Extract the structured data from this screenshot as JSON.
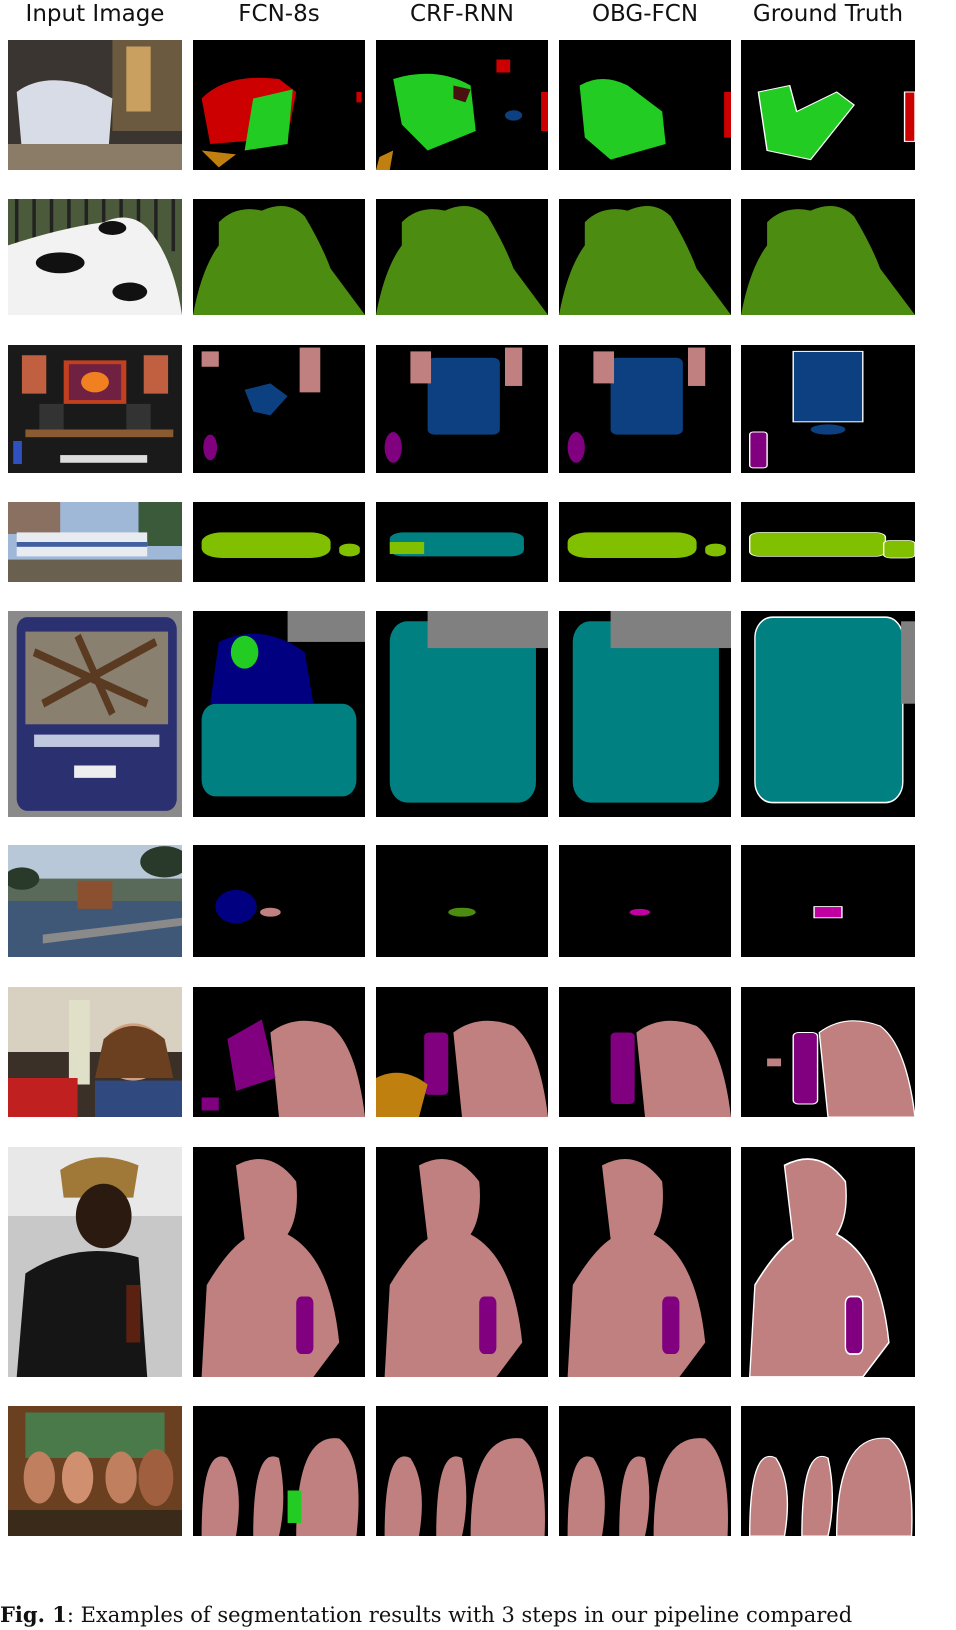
{
  "columns": [
    "Input Image",
    "FCN-8s",
    "CRF-RNN",
    "OBG-FCN",
    "Ground Truth"
  ],
  "rows": [
    {
      "scene": "living room with sofa",
      "shapes": [
        "sofa",
        "sofa-alt",
        "sofa-clean",
        "sofa-gt"
      ]
    },
    {
      "scene": "cow lying down",
      "shapes": [
        "cow",
        "cow",
        "cow",
        "cow"
      ]
    },
    {
      "scene": "desk with computer monitor",
      "shapes": [
        "monitor-fcn",
        "monitor",
        "monitor",
        "monitor-gt"
      ]
    },
    {
      "scene": "train on tracks",
      "shapes": [
        "train",
        "train-teal",
        "train",
        "train-gt"
      ]
    },
    {
      "scene": "bus front",
      "shapes": [
        "bus-fcn",
        "bus",
        "bus",
        "bus-gt"
      ]
    },
    {
      "scene": "harbor with boats",
      "shapes": [
        "harbor-fcn",
        "harbor-crf",
        "harbor-obg",
        "harbor-gt"
      ]
    },
    {
      "scene": "woman with bottle",
      "shapes": [
        "woman-fcn",
        "woman-crf",
        "woman",
        "woman-gt"
      ]
    },
    {
      "scene": "man with bottle",
      "shapes": [
        "man",
        "man",
        "man",
        "man-gt"
      ]
    },
    {
      "scene": "group of people",
      "shapes": [
        "group-fcn",
        "group",
        "group",
        "group-gt"
      ]
    }
  ],
  "caption": {
    "label": "Fig. 1",
    "text": "Examples of segmentation results with 3 steps in our pipeline compared"
  },
  "colors": {
    "background": "#000000",
    "sofa_green": "#22cc22",
    "chair_red": "#cc0000",
    "cow_green": "#4c8c10",
    "tv_blue": "#0c4080",
    "bottle_purple": "#800080",
    "person_pink": "#c08080",
    "train_lime": "#80c000",
    "bus_teal": "#008080",
    "car_gray": "#808080",
    "horse_brown": "#c06000"
  }
}
